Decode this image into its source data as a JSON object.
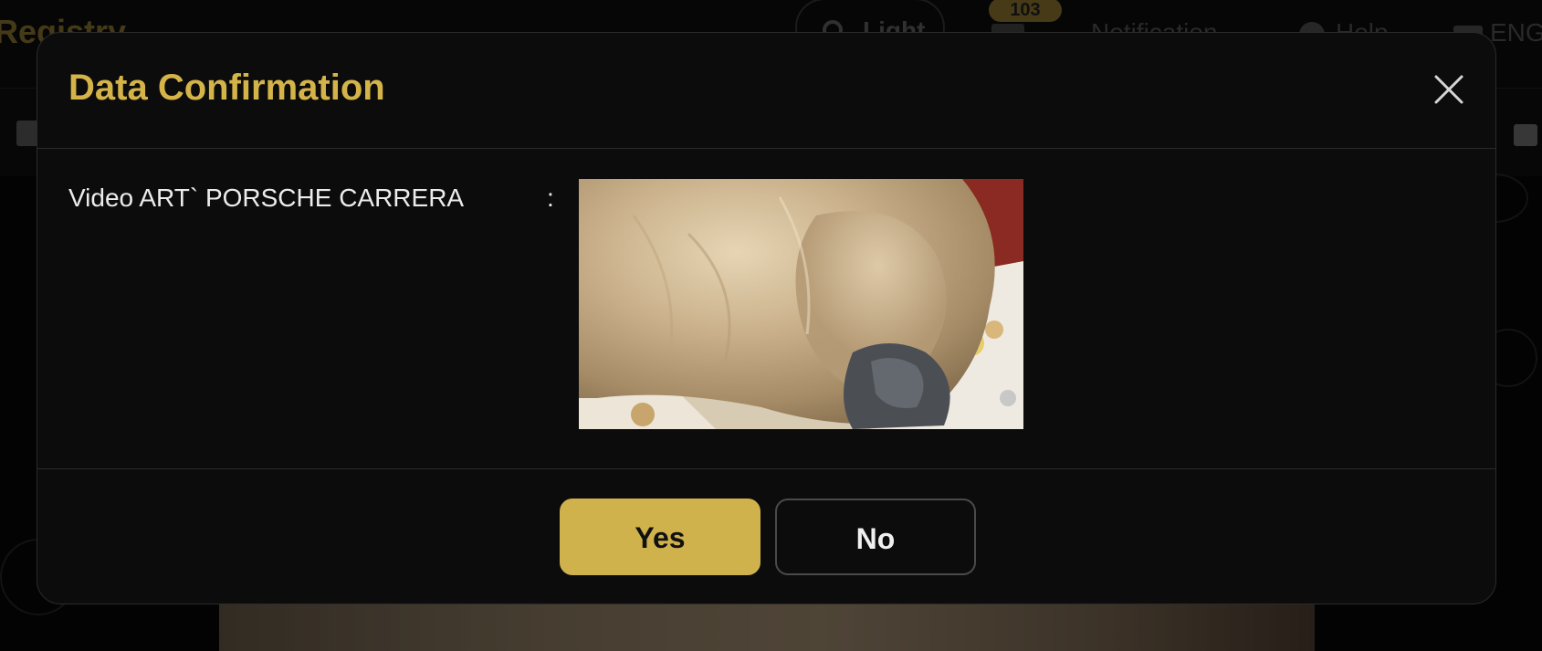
{
  "background": {
    "brand": "Registry",
    "theme_toggle_label": "Light",
    "notification_count": "103",
    "notification_label": "Notification",
    "help_label": "Help",
    "language_label": "ENG"
  },
  "modal": {
    "title": "Data Confirmation",
    "field": {
      "label": "Video ART` PORSCHE CARRERA",
      "separator": ":"
    },
    "buttons": {
      "yes": "Yes",
      "no": "No"
    }
  },
  "colors": {
    "accent": "#d0b24d",
    "title": "#d4b449",
    "modal_bg": "#0c0c0c"
  },
  "icons": {
    "close": "close-icon",
    "theme": "sun-icon",
    "mail": "mail-icon",
    "help": "help-icon",
    "language": "flag-icon",
    "document": "document-icon",
    "bag": "shopping-bag-icon"
  }
}
